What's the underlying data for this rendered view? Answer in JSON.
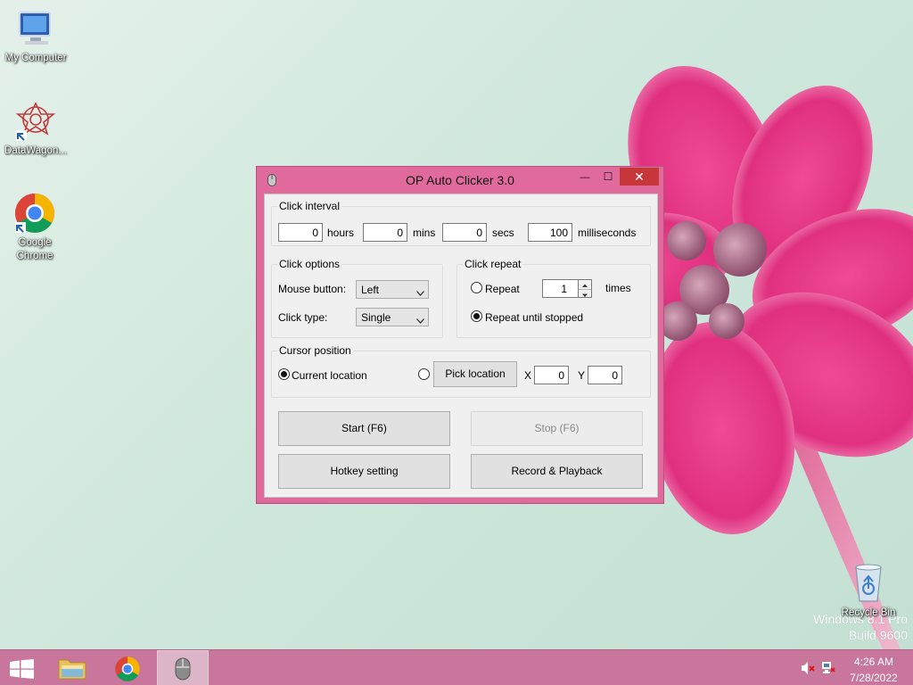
{
  "desktop": {
    "icons": [
      {
        "label": "My Computer",
        "icon": "computer-icon"
      },
      {
        "label": "DataWagon...",
        "icon": "datawagon-icon"
      },
      {
        "label": "Google Chrome",
        "icon": "chrome-icon"
      },
      {
        "label": "Recycle Bin",
        "icon": "recycle-bin-icon"
      }
    ],
    "watermark": {
      "line1": "Windows 8.1 Pro",
      "line2": "Build 9600"
    }
  },
  "window": {
    "title": "OP Auto Clicker 3.0",
    "controls": {
      "minimize": "—",
      "maximize": "☐",
      "close": "✕"
    },
    "click_interval": {
      "label": "Click interval",
      "hours": {
        "value": "0",
        "unit": "hours"
      },
      "mins": {
        "value": "0",
        "unit": "mins"
      },
      "secs": {
        "value": "0",
        "unit": "secs"
      },
      "milliseconds": {
        "value": "100",
        "unit": "milliseconds"
      }
    },
    "click_options": {
      "label": "Click options",
      "mouse_button_label": "Mouse button:",
      "mouse_button_value": "Left",
      "click_type_label": "Click type:",
      "click_type_value": "Single"
    },
    "click_repeat": {
      "label": "Click repeat",
      "repeat_label": "Repeat",
      "repeat_checked": false,
      "repeat_count": "1",
      "times_label": "times",
      "until_stopped_label": "Repeat until stopped",
      "until_stopped_checked": true
    },
    "cursor_position": {
      "label": "Cursor position",
      "current_location_label": "Current location",
      "current_location_checked": true,
      "pick_location_label": "Pick location",
      "x_label": "X",
      "x_value": "0",
      "y_label": "Y",
      "y_value": "0"
    },
    "buttons": {
      "start": "Start (F6)",
      "stop": "Stop (F6)",
      "hotkey": "Hotkey setting",
      "record": "Record & Playback"
    }
  },
  "taskbar": {
    "clock_time": "4:26 AM",
    "clock_date": "7/28/2022"
  },
  "colors": {
    "window_frame": "#e06a9c",
    "taskbar": "#c9769d",
    "close_button": "#c7373a"
  }
}
